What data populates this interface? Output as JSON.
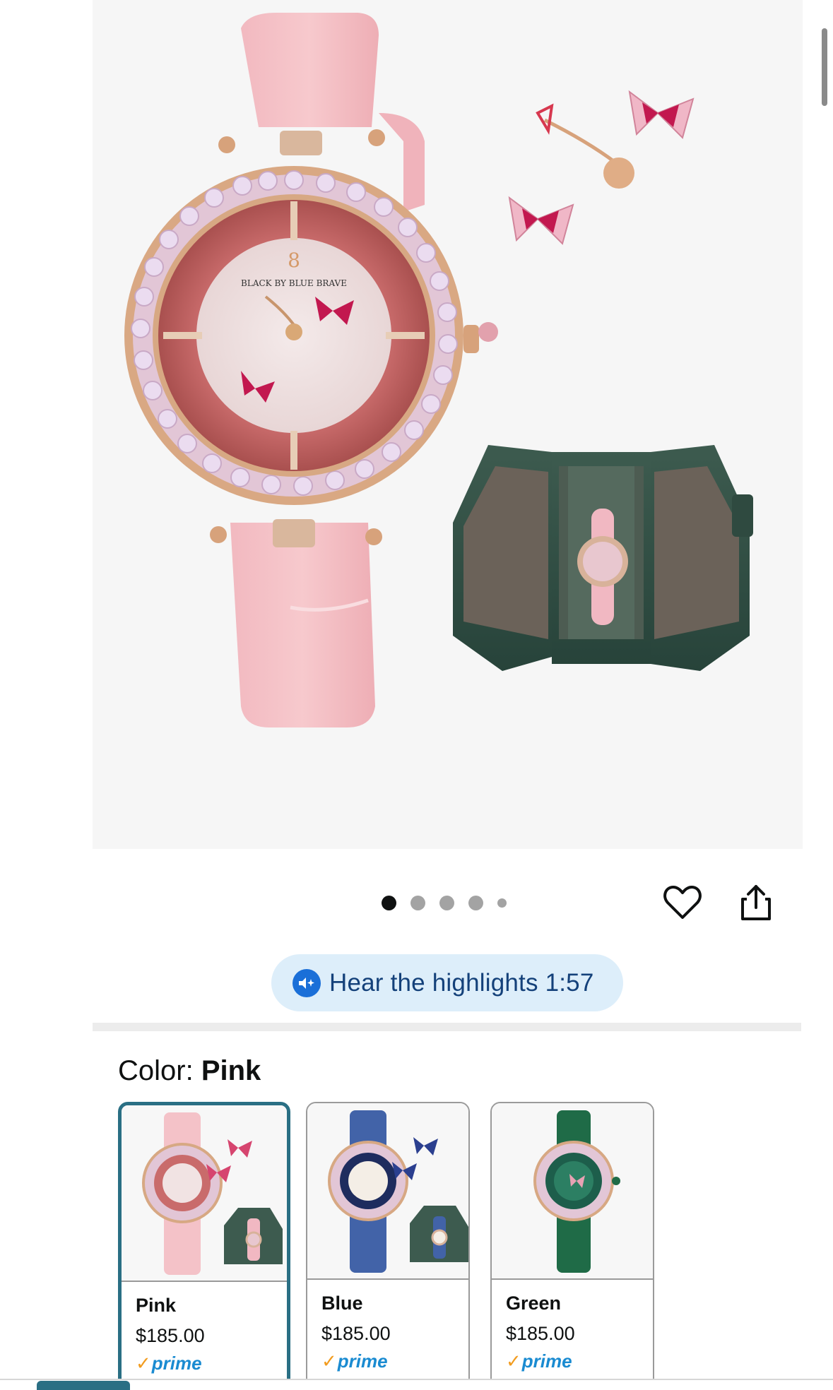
{
  "gallery": {
    "brand_text": "BLACK BY BLUE BRAVE",
    "dots": 5,
    "active_dot": 0
  },
  "actions": {
    "favorite_icon": "heart-icon",
    "share_icon": "share-icon"
  },
  "highlights": {
    "label": "Hear the highlights 1:57",
    "icon": "audio-sparkle-icon"
  },
  "color": {
    "prefix": "Color: ",
    "selected": "Pink",
    "options": [
      {
        "name": "Pink",
        "price": "$185.00",
        "prime": "prime"
      },
      {
        "name": "Blue",
        "price": "$185.00",
        "prime": "prime"
      },
      {
        "name": "Green",
        "price": "$185.00",
        "prime": "prime"
      }
    ]
  },
  "colors": {
    "selected_border": "#2a6f84",
    "pill_bg": "#ddeefa",
    "pill_text": "#14417a",
    "prime_blue": "#1a8bd1",
    "prime_check": "#f29c1f"
  }
}
